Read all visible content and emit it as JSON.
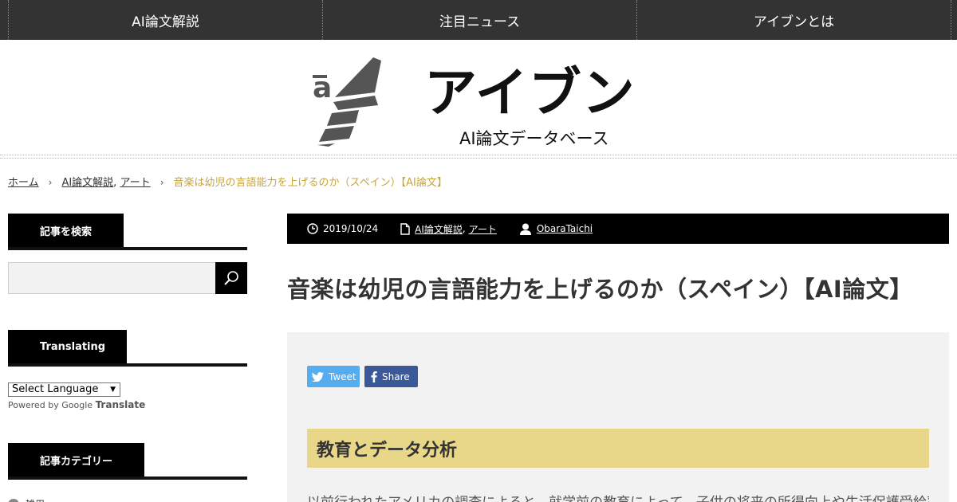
{
  "nav": {
    "items": [
      "AI論文解説",
      "注目ニュース",
      "アイブンとは"
    ]
  },
  "header": {
    "logo_title": "アイブン",
    "logo_subtitle": "AI論文データベース",
    "logo_mark_letter": "a"
  },
  "breadcrumb": {
    "home": "ホーム",
    "cat1": "AI論文解説",
    "comma": ",",
    "cat2": "アート",
    "separator": "›",
    "current": "音楽は幼児の言語能力を上げるのか（スペイン）【AI論文】"
  },
  "sidebar": {
    "search_title": "記事を検索",
    "search_value": "",
    "translate_title": "Translating",
    "language_select": "Select Language",
    "powered_by": "Powered by",
    "google": "Google",
    "translate": "Translate",
    "category_title": "記事カテゴリー",
    "category_first": "雑用"
  },
  "article": {
    "date": "2019/10/24",
    "cat1": "AI論文解説",
    "comma": ",",
    "cat2": "アート",
    "author": "ObaraTaichi",
    "title": "音楽は幼児の言語能力を上げるのか（スペイン）【AI論文】",
    "tweet_label": "Tweet",
    "share_label": "Share",
    "section_heading": "教育とデータ分析",
    "body_first_line": "以前行われたアメリカの調査によると、就学前の教育によって、子供の将来の所得向上や生活保護受給率の"
  },
  "colors": {
    "nav_bg": "#333333",
    "accent_gold": "#c8a43c",
    "section_bg": "#e8d689",
    "twitter": "#55acee",
    "facebook": "#3b5998"
  },
  "icons": {
    "search": "search-icon",
    "clock": "clock-icon",
    "document": "document-icon",
    "user": "user-icon",
    "twitter": "twitter-icon",
    "facebook": "facebook-icon"
  }
}
